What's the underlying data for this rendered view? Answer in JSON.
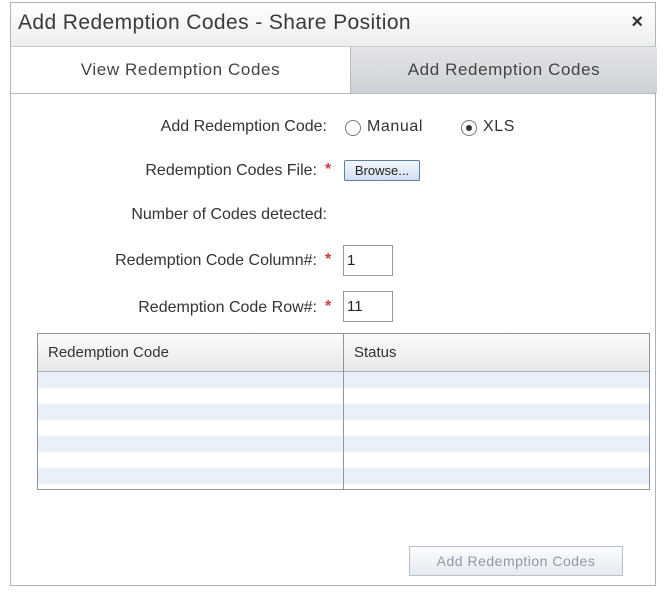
{
  "dialog": {
    "title": "Add Redemption Codes - Share Position",
    "close_glyph": "×"
  },
  "tabs": [
    {
      "label": "View Redemption Codes",
      "active": false
    },
    {
      "label": "Add Redemption Codes",
      "active": true
    }
  ],
  "form": {
    "mode_label": "Add Redemption Code:",
    "mode_options": [
      {
        "label": "Manual",
        "selected": false
      },
      {
        "label": "XLS",
        "selected": true
      }
    ],
    "file_label": "Redemption Codes File:",
    "browse_label": "Browse...",
    "detected_label": "Number of Codes detected:",
    "column_label": "Redemption Code Column#:",
    "column_value": "1",
    "row_label": "Redemption Code Row#:",
    "row_value": "11",
    "required_marker": "*"
  },
  "grid": {
    "columns": [
      "Redemption Code",
      "Status"
    ],
    "rows": [
      {
        "code": "",
        "status": ""
      },
      {
        "code": "",
        "status": ""
      },
      {
        "code": "",
        "status": ""
      },
      {
        "code": "",
        "status": ""
      },
      {
        "code": "",
        "status": ""
      },
      {
        "code": "",
        "status": ""
      },
      {
        "code": "",
        "status": ""
      }
    ]
  },
  "submit_label": "Add Redemption Codes",
  "colors": {
    "required": "#d23a3a",
    "row_alt": "#e9f0fa",
    "active_tab": "#d6d9dc",
    "disabled_text": "#8f99a3"
  }
}
